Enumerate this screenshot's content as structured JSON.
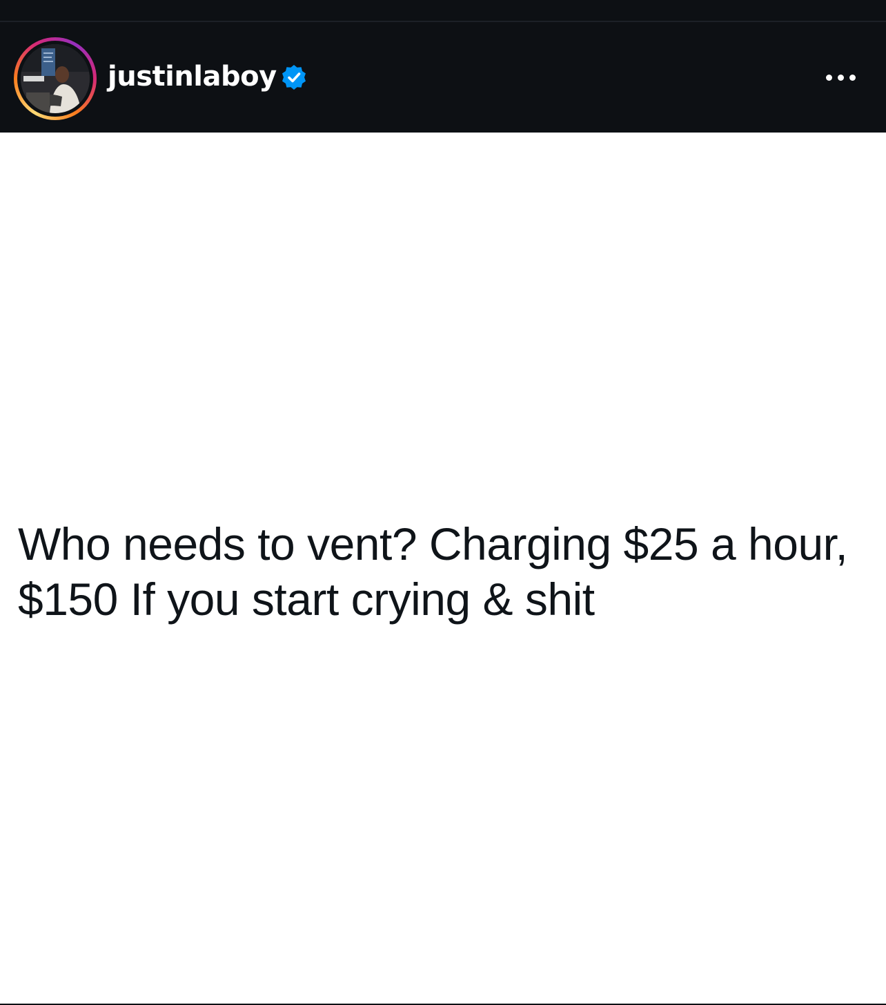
{
  "header": {
    "username": "justinlaboy",
    "verified": true,
    "verified_icon": "verified-badge-icon",
    "more_icon": "more-options-icon",
    "avatar_icon": "profile-avatar",
    "accent_color": "#0095f6"
  },
  "post": {
    "lines": [
      "Who needs to vent? Charging $25 a hour,",
      "$150 If you start crying & shit"
    ]
  },
  "colors": {
    "header_bg": "#0d1014",
    "post_bg": "#ffffff",
    "text": "#0f1419"
  }
}
